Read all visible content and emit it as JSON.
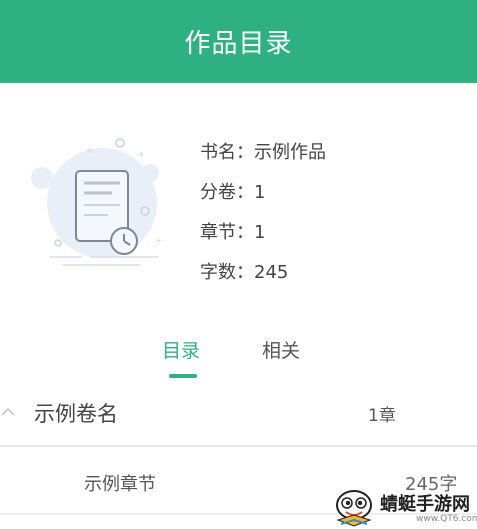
{
  "header": {
    "title": "作品目录"
  },
  "book_info": {
    "rows": [
      {
        "label": "书名：",
        "value": "示例作品"
      },
      {
        "label": "分卷：",
        "value": "1"
      },
      {
        "label": "章节：",
        "value": "1"
      },
      {
        "label": "字数：",
        "value": "245"
      }
    ]
  },
  "tabs": {
    "catalog": "目录",
    "related": "相关",
    "active": "catalog"
  },
  "volume": {
    "name": "示例卷名",
    "chapter_count": "1章",
    "expanded": true
  },
  "chapters": [
    {
      "name": "示例章节",
      "words": "245字"
    }
  ],
  "watermark": {
    "title": "蜻蜓手游网",
    "url": "www.QT6.com"
  },
  "colors": {
    "accent": "#2fb083",
    "text": "#444444",
    "divider": "#e8e8e8"
  },
  "icons": {
    "illustration": "document-clock-illustration",
    "collapse": "chevron-up-icon",
    "watermark": "dragonfly-mascot-logo"
  }
}
